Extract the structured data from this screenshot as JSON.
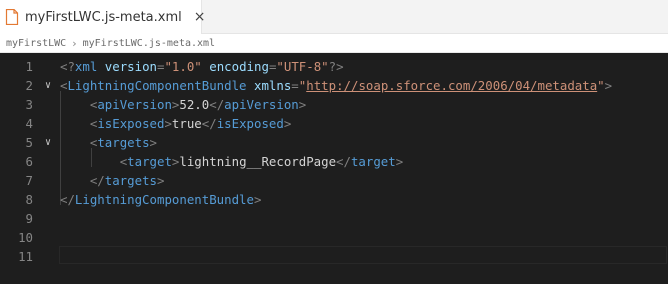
{
  "tab": {
    "title": "myFirstLWC.js-meta.xml",
    "close": "×"
  },
  "breadcrumb": {
    "folder": "myFirstLWC",
    "separator": "›",
    "file": "myFirstLWC.js-meta.xml"
  },
  "colors": {
    "tag": "#569cd6",
    "attr": "#9cdcfe",
    "string": "#ce9178",
    "punctuation": "#808080",
    "text": "#d4d4d4",
    "line_number": "#858585"
  },
  "lines": [
    {
      "num": "1",
      "fold": "",
      "tokens": [
        [
          "punc",
          "<?"
        ],
        [
          "tag",
          "xml"
        ],
        [
          "text",
          " "
        ],
        [
          "attr",
          "version"
        ],
        [
          "punc",
          "="
        ],
        [
          "str",
          "\"1.0\""
        ],
        [
          "text",
          " "
        ],
        [
          "attr",
          "encoding"
        ],
        [
          "punc",
          "="
        ],
        [
          "str",
          "\"UTF-8\""
        ],
        [
          "punc",
          "?>"
        ]
      ]
    },
    {
      "num": "2",
      "fold": "∨",
      "tokens": [
        [
          "punc",
          "<"
        ],
        [
          "tag",
          "LightningComponentBundle"
        ],
        [
          "text",
          " "
        ],
        [
          "attr",
          "xmlns"
        ],
        [
          "punc",
          "="
        ],
        [
          "str",
          "\""
        ],
        [
          "url",
          "http://soap.sforce.com/2006/04/metadata"
        ],
        [
          "str",
          "\""
        ],
        [
          "punc",
          ">"
        ]
      ]
    },
    {
      "num": "3",
      "fold": "",
      "tokens": [
        [
          "text",
          "    "
        ],
        [
          "punc",
          "<"
        ],
        [
          "tag",
          "apiVersion"
        ],
        [
          "punc",
          ">"
        ],
        [
          "text",
          "52.0"
        ],
        [
          "punc",
          "</"
        ],
        [
          "tag",
          "apiVersion"
        ],
        [
          "punc",
          ">"
        ]
      ]
    },
    {
      "num": "4",
      "fold": "",
      "tokens": [
        [
          "text",
          "    "
        ],
        [
          "punc",
          "<"
        ],
        [
          "tag",
          "isExposed"
        ],
        [
          "punc",
          ">"
        ],
        [
          "text",
          "true"
        ],
        [
          "punc",
          "</"
        ],
        [
          "tag",
          "isExposed"
        ],
        [
          "punc",
          ">"
        ]
      ]
    },
    {
      "num": "5",
      "fold": "∨",
      "tokens": [
        [
          "text",
          "    "
        ],
        [
          "punc",
          "<"
        ],
        [
          "tag",
          "targets"
        ],
        [
          "punc",
          ">"
        ]
      ]
    },
    {
      "num": "6",
      "fold": "",
      "tokens": [
        [
          "text",
          "        "
        ],
        [
          "punc",
          "<"
        ],
        [
          "tag",
          "target"
        ],
        [
          "punc",
          ">"
        ],
        [
          "text",
          "lightning__RecordPage"
        ],
        [
          "punc",
          "</"
        ],
        [
          "tag",
          "target"
        ],
        [
          "punc",
          ">"
        ]
      ]
    },
    {
      "num": "7",
      "fold": "",
      "tokens": [
        [
          "text",
          "    "
        ],
        [
          "punc",
          "</"
        ],
        [
          "tag",
          "targets"
        ],
        [
          "punc",
          ">"
        ]
      ]
    },
    {
      "num": "8",
      "fold": "",
      "tokens": [
        [
          "punc",
          "</"
        ],
        [
          "tag",
          "LightningComponentBundle"
        ],
        [
          "punc",
          ">"
        ]
      ]
    },
    {
      "num": "9",
      "fold": "",
      "tokens": []
    },
    {
      "num": "10",
      "fold": "",
      "tokens": []
    },
    {
      "num": "11",
      "fold": "",
      "tokens": []
    }
  ]
}
